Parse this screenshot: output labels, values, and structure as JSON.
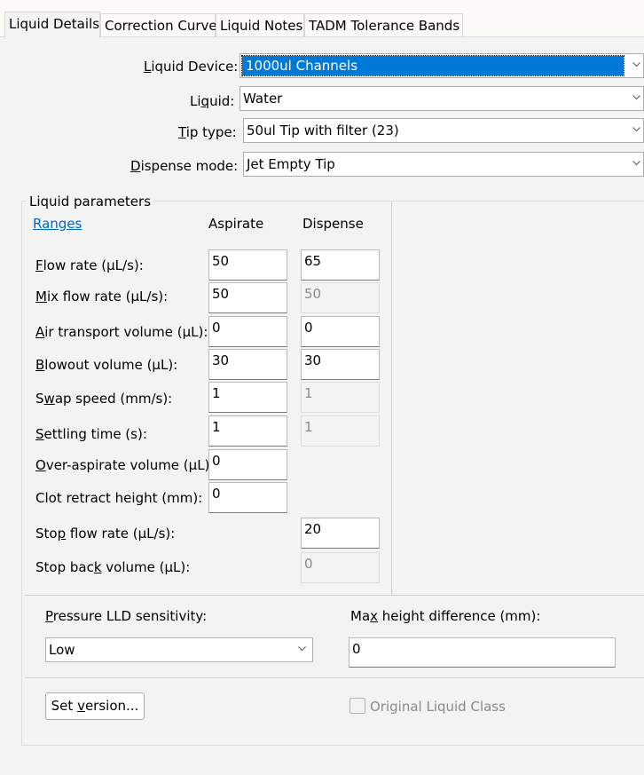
{
  "tabs": [
    {
      "label": "Liquid Details"
    },
    {
      "label": "Correction Curve"
    },
    {
      "label": "Liquid Notes"
    },
    {
      "label": "TADM Tolerance Bands"
    }
  ],
  "selectors": {
    "liquid_device": {
      "label_pre": "",
      "label_key": "L",
      "label_post": "iquid Device:",
      "value": "1000ul Channels"
    },
    "liquid": {
      "label_pre": "Li",
      "label_key": "q",
      "label_post": "uid:",
      "value": "Water"
    },
    "tip_type": {
      "label_pre": "",
      "label_key": "T",
      "label_post": "ip type:",
      "value": "50ul Tip with filter (23)"
    },
    "dispense_mode": {
      "label_pre": "",
      "label_key": "D",
      "label_post": "ispense mode:",
      "value": "Jet Empty Tip"
    }
  },
  "params": {
    "group_title": "Liquid parameters",
    "ranges_link": "Ranges",
    "col_aspirate": "Aspirate",
    "col_dispense": "Dispense",
    "rows": [
      {
        "pre": "",
        "key": "F",
        "post": "low rate (µL/s):",
        "asp": "50",
        "disp": "65"
      },
      {
        "pre": "",
        "key": "M",
        "post": "ix flow rate (µL/s):",
        "asp": "50",
        "disp": "50"
      },
      {
        "pre": "",
        "key": "A",
        "post": "ir transport volume (µL):",
        "asp": "0",
        "disp": "0"
      },
      {
        "pre": "",
        "key": "B",
        "post": "lowout volume (µL):",
        "asp": "30",
        "disp": "30"
      },
      {
        "pre": "S",
        "key": "w",
        "post": "ap speed (mm/s):",
        "asp": "1",
        "disp": "1"
      },
      {
        "pre": "",
        "key": "S",
        "post": "ettling time (s):",
        "asp": "1",
        "disp": "1"
      },
      {
        "pre": "",
        "key": "O",
        "post": "ver-aspirate volume (µL):",
        "asp": "0"
      },
      {
        "pre": "Clot retract height (mm):",
        "key": "",
        "post": "",
        "asp": "0"
      },
      {
        "pre": "Sto",
        "key": "p",
        "post": " flow rate (µL/s):",
        "disp": "20"
      },
      {
        "pre": "Stop bac",
        "key": "k",
        "post": " volume (µL):",
        "disp": "0"
      }
    ]
  },
  "pressure": {
    "label_pre": "",
    "label_key": "P",
    "label_post": "ressure LLD sensitivity:",
    "value": "Low"
  },
  "max_height": {
    "label_pre": "Ma",
    "label_key": "x",
    "label_post": " height difference (mm):",
    "value": "0"
  },
  "set_version_button": {
    "pre": "Set ",
    "key": "v",
    "post": "ersion..."
  },
  "original_liquid_class": {
    "label": "Original Liquid Class",
    "checked": false
  }
}
